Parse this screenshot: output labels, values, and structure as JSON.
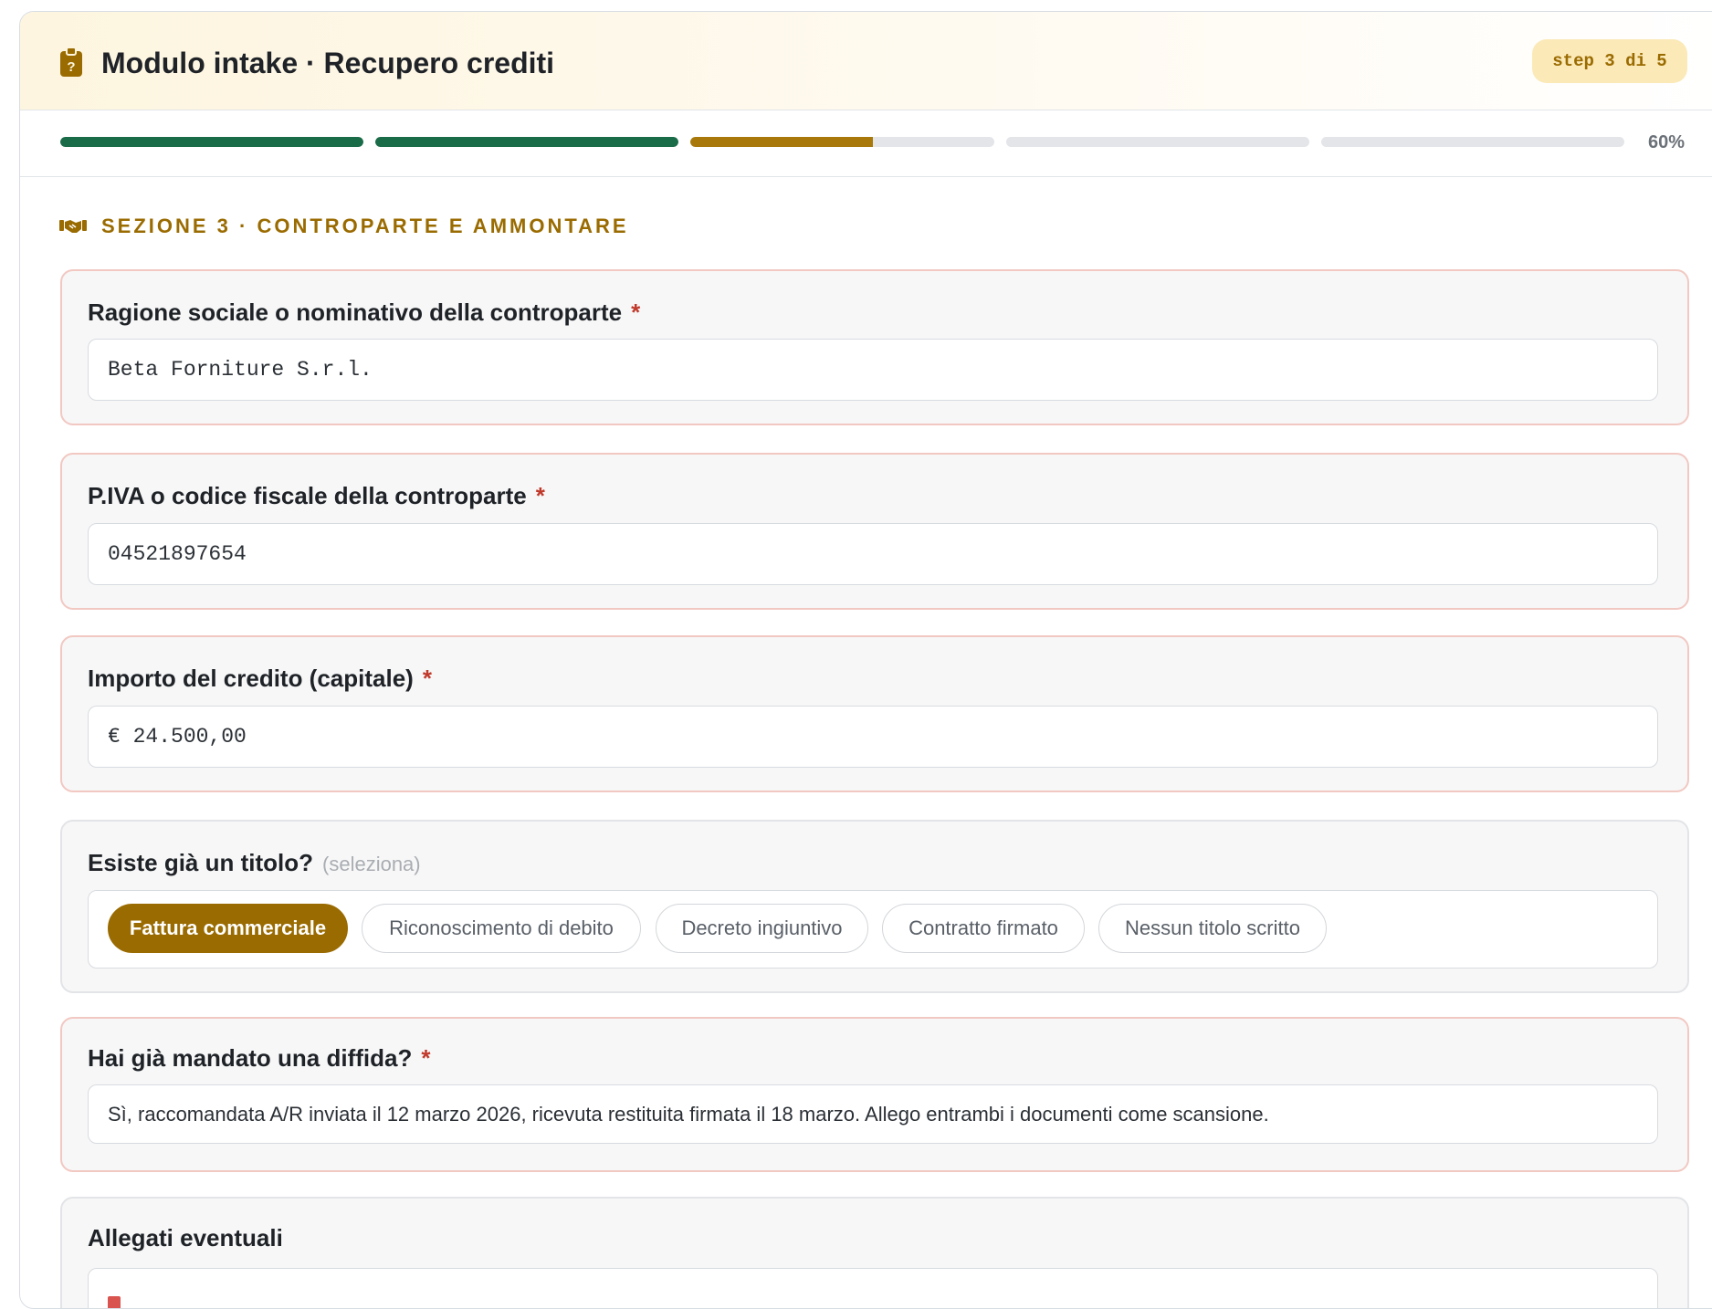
{
  "header": {
    "title": "Modulo intake · Recupero crediti",
    "step_label": "step 3 di 5",
    "icon": "clipboard-question-icon"
  },
  "progress": {
    "percent_label": "60%",
    "segments": [
      {
        "fill": 1.0,
        "color": "#1a6b47"
      },
      {
        "fill": 1.0,
        "color": "#1a6b47"
      },
      {
        "fill": 0.6,
        "color": "#a8790a"
      },
      {
        "fill": 0.0,
        "color": "#a8790a"
      },
      {
        "fill": 0.0,
        "color": "#a8790a"
      }
    ]
  },
  "section": {
    "title": "SEZIONE 3 · CONTROPARTE E AMMONTARE",
    "icon": "handshake-icon"
  },
  "fields": {
    "counterparty_name": {
      "label": "Ragione sociale o nominativo della controparte",
      "required": "*",
      "value": "Beta Forniture S.r.l."
    },
    "vat_code": {
      "label": "P.IVA o codice fiscale della controparte",
      "required": "*",
      "value": "04521897654"
    },
    "amount": {
      "label": "Importo del credito (capitale)",
      "required": "*",
      "value": "€ 24.500,00"
    },
    "title_exists": {
      "label": "Esiste già un titolo?",
      "hint": "(seleziona)",
      "options": [
        "Fattura commerciale",
        "Riconoscimento di debito",
        "Decreto ingiuntivo",
        "Contratto firmato",
        "Nessun titolo scritto"
      ],
      "selected": "Fattura commerciale"
    },
    "warning_sent": {
      "label": "Hai già mandato una diffida?",
      "required": "*",
      "value": "Sì, raccomandata A/R inviata il 12 marzo 2026, ricevuta restituita firmata il 18 marzo. Allego entrambi i documenti come scansione."
    },
    "attachments": {
      "label": "Allegati eventuali"
    }
  },
  "colors": {
    "accent": "#9a6b00",
    "progress_done": "#1a6b47",
    "progress_current": "#a8790a",
    "required_star": "#c0392b"
  }
}
